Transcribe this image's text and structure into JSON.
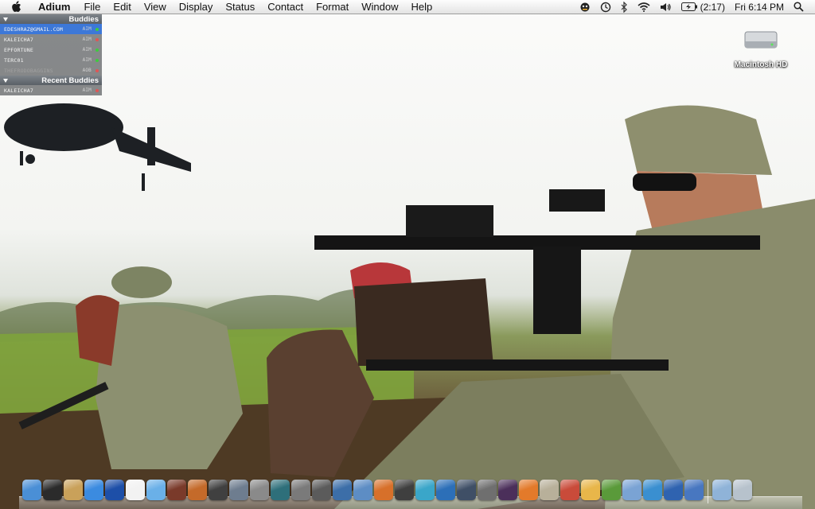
{
  "menubar": {
    "app_name": "Adium",
    "menus": [
      "File",
      "Edit",
      "View",
      "Display",
      "Status",
      "Contact",
      "Format",
      "Window",
      "Help"
    ],
    "battery_text": "(2:17)",
    "clock": "Fri 6:14 PM"
  },
  "buddy_list": {
    "group_title": "Buddies",
    "buddies": [
      {
        "name": "edeshraz@gmail.com",
        "service": "AIM",
        "status_color": "#3ecb3e"
      },
      {
        "name": "kaleicha7",
        "service": "AIM",
        "status_color": "#e05555"
      },
      {
        "name": "epfortune",
        "service": "AIM",
        "status_color": "#3ecb3e"
      },
      {
        "name": "terc01",
        "service": "AIM",
        "status_color": "#3ecb3e"
      },
      {
        "name": "thefrodobaggins",
        "service": "AOB",
        "status_color": "#e05555"
      }
    ],
    "recent_title": "Recent Buddies",
    "recent": [
      {
        "name": "kaleicha7",
        "service": "AIM",
        "status_color": "#e05555"
      }
    ]
  },
  "desktop": {
    "hd_label": "Macintosh HD"
  },
  "dock": {
    "icons": [
      {
        "name": "finder-icon",
        "color": "#4a8fd6"
      },
      {
        "name": "dashboard-icon",
        "color": "#2b2b2b"
      },
      {
        "name": "mail-stamp-icon",
        "color": "#c9a15a"
      },
      {
        "name": "safari-icon",
        "color": "#3b8be0"
      },
      {
        "name": "network-globe-icon",
        "color": "#1d4fa8"
      },
      {
        "name": "textedit-icon",
        "color": "#f2f2f2"
      },
      {
        "name": "itunes-icon",
        "color": "#6ab0e8"
      },
      {
        "name": "photo-booth-icon",
        "color": "#7a3a2a"
      },
      {
        "name": "guitar-icon",
        "color": "#c46a2a"
      },
      {
        "name": "dvd-player-icon",
        "color": "#404040"
      },
      {
        "name": "expose-icon",
        "color": "#6e7d8f"
      },
      {
        "name": "preview-icon",
        "color": "#8a8a8a"
      },
      {
        "name": "time-machine-icon",
        "color": "#2e6f7a"
      },
      {
        "name": "system-preferences-icon",
        "color": "#7a7a7a"
      },
      {
        "name": "ical-icon",
        "color": "#5b5b5b"
      },
      {
        "name": "airplane-icon",
        "color": "#3c6ea8"
      },
      {
        "name": "xcode-icon",
        "color": "#5d8dc4"
      },
      {
        "name": "firefox-icon",
        "color": "#d7702a"
      },
      {
        "name": "terminal-icon",
        "color": "#3f3f3f"
      },
      {
        "name": "mail-at-icon",
        "color": "#3aa6c9"
      },
      {
        "name": "display-icon",
        "color": "#2c6fb8"
      },
      {
        "name": "utility-icon",
        "color": "#3f4f66"
      },
      {
        "name": "tools-icon",
        "color": "#6f6f6f"
      },
      {
        "name": "photoshop-icon",
        "color": "#4b2f5a"
      },
      {
        "name": "vlc-icon",
        "color": "#e37a2a"
      },
      {
        "name": "books-icon",
        "color": "#b8b09a"
      },
      {
        "name": "burn-icon",
        "color": "#c94b3a"
      },
      {
        "name": "adium-duck-icon",
        "color": "#e8b64a"
      },
      {
        "name": "sims-icon",
        "color": "#5a9a3a"
      },
      {
        "name": "clipboard-icon",
        "color": "#7aa3d4"
      },
      {
        "name": "box-icon",
        "color": "#3a8fd0"
      },
      {
        "name": "application-icon",
        "color": "#2f63b0"
      },
      {
        "name": "web-sharing-icon",
        "color": "#4877c0"
      }
    ],
    "right_icons": [
      {
        "name": "documents-folder-icon",
        "color": "#8fb3d8"
      },
      {
        "name": "trash-icon",
        "color": "#b7c2cc"
      }
    ]
  }
}
